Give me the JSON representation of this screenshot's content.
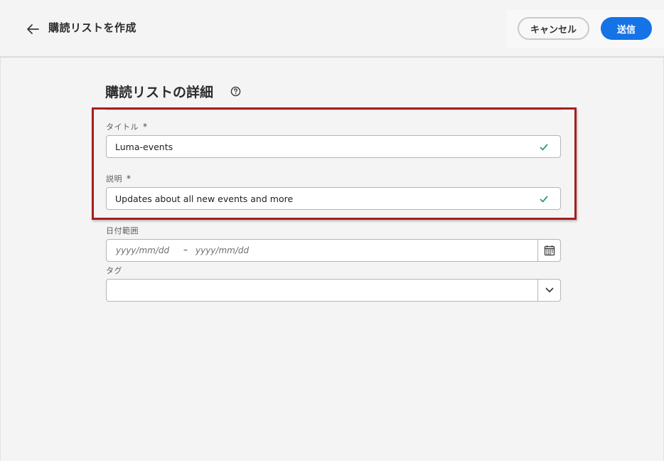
{
  "header": {
    "title": "購読リストを作成",
    "cancel_label": "キャンセル",
    "submit_label": "送信"
  },
  "section": {
    "title": "購読リストの詳細"
  },
  "form": {
    "title_label": "タイトル",
    "title_value": "Luma-events",
    "description_label": "説明",
    "description_value": "Updates about all new events and more",
    "required_marker": "*",
    "date_range_label": "日付範囲",
    "date_start_placeholder": "yyyy/mm/dd",
    "date_separator": "–",
    "date_end_placeholder": "yyyy/mm/dd",
    "tags_label": "タグ",
    "tags_value": ""
  },
  "colors": {
    "accent": "#1473e6",
    "highlight_border": "#a81d1d",
    "valid_check": "#2d9d78"
  },
  "icons": [
    "arrow-left-icon",
    "help-icon",
    "checkmark-icon",
    "calendar-icon",
    "chevron-down-icon"
  ]
}
